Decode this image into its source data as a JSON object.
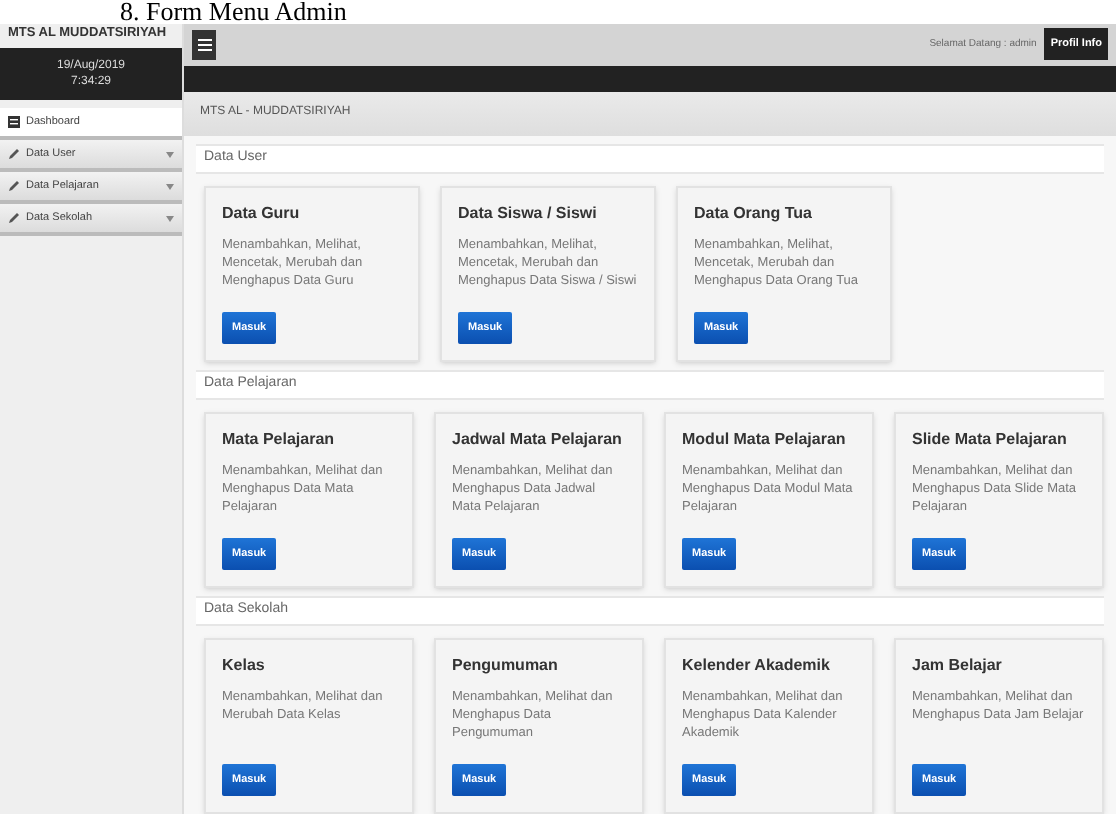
{
  "caption": "8. Form Menu Admin",
  "sidebar": {
    "brand": "MTS AL MUDDATSIRIYAH",
    "date": "19/Aug/2019",
    "time": "7:34:29",
    "items": [
      {
        "label": "Dashboard",
        "kind": "dashboard",
        "selected": true,
        "expandable": false
      },
      {
        "label": "Data User",
        "kind": "pencil",
        "selected": false,
        "expandable": true
      },
      {
        "label": "Data Pelajaran",
        "kind": "pencil",
        "selected": false,
        "expandable": true
      },
      {
        "label": "Data Sekolah",
        "kind": "pencil",
        "selected": false,
        "expandable": true
      }
    ]
  },
  "topbar": {
    "greeting": "Selamat Datang : admin",
    "profile_button": "Profil Info"
  },
  "page_title": "MTS AL - MUDDATSIRIYAH",
  "sections": [
    {
      "title": "Data User",
      "cards": [
        {
          "title": "Data Guru",
          "description": "Menambahkan, Melihat, Mencetak, Merubah dan Menghapus Data Guru",
          "button": "Masuk"
        },
        {
          "title": "Data Siswa / Siswi",
          "description": "Menambahkan, Melihat, Mencetak, Merubah dan Menghapus Data Siswa / Siswi",
          "button": "Masuk"
        },
        {
          "title": "Data Orang Tua",
          "description": "Menambahkan, Melihat, Mencetak, Merubah dan Menghapus Data Orang Tua",
          "button": "Masuk"
        }
      ]
    },
    {
      "title": "Data Pelajaran",
      "cards": [
        {
          "title": "Mata Pelajaran",
          "description": "Menambahkan, Melihat dan Menghapus Data Mata Pelajaran",
          "button": "Masuk"
        },
        {
          "title": "Jadwal Mata Pelajaran",
          "description": "Menambahkan, Melihat dan Menghapus Data Jadwal Mata Pelajaran",
          "button": "Masuk"
        },
        {
          "title": "Modul Mata Pelajaran",
          "description": "Menambahkan, Melihat dan Menghapus Data Modul Mata Pelajaran",
          "button": "Masuk"
        },
        {
          "title": "Slide Mata Pelajaran",
          "description": "Menambahkan, Melihat dan Menghapus Data Slide Mata Pelajaran",
          "button": "Masuk"
        }
      ]
    },
    {
      "title": "Data Sekolah",
      "cards": [
        {
          "title": "Kelas",
          "description": "Menambahkan, Melihat dan Merubah Data Kelas",
          "button": "Masuk"
        },
        {
          "title": "Pengumuman",
          "description": "Menambahkan, Melihat dan Menghapus Data Pengumuman",
          "button": "Masuk"
        },
        {
          "title": "Kelender Akademik",
          "description": "Menambahkan, Melihat dan Menghapus Data Kalender Akademik",
          "button": "Masuk"
        },
        {
          "title": "Jam Belajar",
          "description": "Menambahkan, Melihat dan Menghapus Data Jam Belajar",
          "button": "Masuk"
        }
      ]
    }
  ]
}
